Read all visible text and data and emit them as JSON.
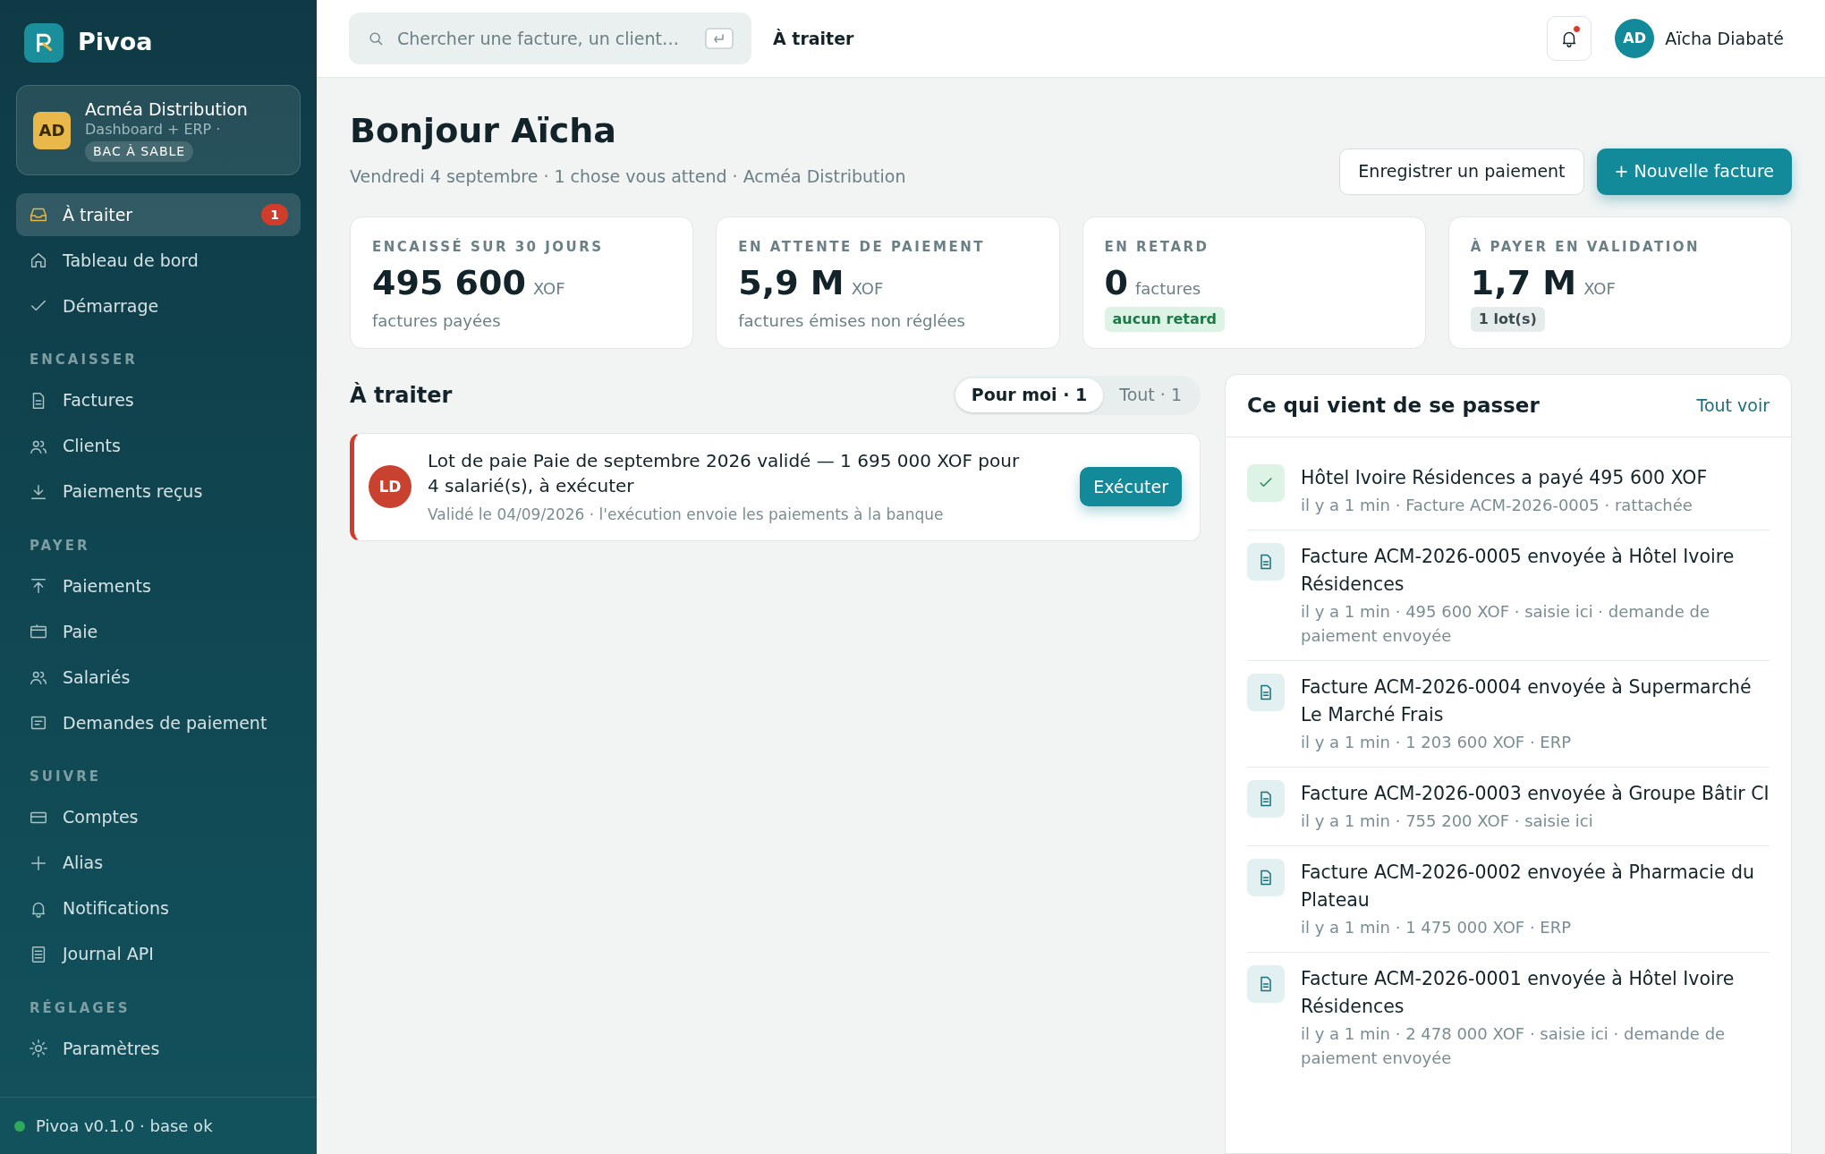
{
  "sidebar": {
    "brand": "Pivoa",
    "org": {
      "initials": "AD",
      "name": "Acméa Distribution",
      "subtitle": "Dashboard + ERP ·",
      "tag": "BAC À SABLE"
    },
    "groups": [
      {
        "items": [
          {
            "label": "À traiter",
            "selected": true,
            "badge": "1"
          },
          {
            "label": "Tableau de bord",
            "selected": false
          },
          {
            "label": "Démarrage",
            "selected": false
          }
        ]
      },
      {
        "heading": "ENCAISSER",
        "items": [
          {
            "label": "Factures",
            "selected": false
          },
          {
            "label": "Clients",
            "selected": false
          },
          {
            "label": "Paiements reçus",
            "selected": false
          }
        ]
      },
      {
        "heading": "PAYER",
        "items": [
          {
            "label": "Paiements",
            "selected": false
          },
          {
            "label": "Paie",
            "selected": false
          },
          {
            "label": "Salariés",
            "selected": false
          },
          {
            "label": "Demandes de paiement",
            "selected": false
          }
        ]
      },
      {
        "heading": "SUIVRE",
        "items": [
          {
            "label": "Comptes",
            "selected": false
          },
          {
            "label": "Alias",
            "selected": false
          },
          {
            "label": "Notifications",
            "selected": false
          },
          {
            "label": "Journal API",
            "selected": false
          }
        ]
      },
      {
        "heading": "RÉGLAGES",
        "items": [
          {
            "label": "Paramètres",
            "selected": false
          }
        ]
      }
    ],
    "footer": {
      "text": "Pivoa v0.1.0 · base ok",
      "status_ok": true
    }
  },
  "topbar": {
    "search": {
      "placeholder": "Chercher une facture, un client…"
    },
    "page_title": "À traiter",
    "notifications": {
      "unread": true
    },
    "user": {
      "initials": "AD",
      "name": "Aïcha Diabaté"
    }
  },
  "header": {
    "title": "Bonjour Aïcha",
    "subtitle": "Vendredi 4 septembre · 1 chose vous attend · Acméa Distribution",
    "buttons": [
      {
        "label": "Enregistrer un paiement",
        "kind": "secondary"
      },
      {
        "label": "+ Nouvelle facture",
        "kind": "primary"
      }
    ]
  },
  "kpis": [
    {
      "label": "ENCAISSÉ SUR 30 JOURS",
      "value": "495 600",
      "unit": "XOF",
      "note": "factures payées",
      "kind": "text"
    },
    {
      "label": "EN ATTENTE DE PAIEMENT",
      "value": "5,9 M",
      "unit": "XOF",
      "note": "factures émises non réglées",
      "kind": "text"
    },
    {
      "label": "EN RETARD",
      "value": "0",
      "unit": "factures",
      "note": "aucun retard",
      "kind": "success"
    },
    {
      "label": "À PAYER EN VALIDATION",
      "value": "1,7 M",
      "unit": "XOF",
      "note": "1 lot(s)",
      "kind": "neutral"
    }
  ],
  "tasks": {
    "title": "À traiter",
    "filters": [
      {
        "label": "Pour moi · 1",
        "selected": true
      },
      {
        "label": "Tout · 1",
        "selected": false
      }
    ],
    "items": [
      {
        "initials": "LD",
        "title": "Lot de paie Paie de septembre 2026 validé — 1 695 000 XOF pour 4 salarié(s), à exécuter",
        "meta": "Validé le 04/09/2026 · l'exécution envoie les paiements à la banque",
        "action": "Exécuter"
      }
    ]
  },
  "activity": {
    "title": "Ce qui vient de se passer",
    "link": "Tout voir",
    "items": [
      {
        "kind": "payment",
        "title": "Hôtel Ivoire Résidences a payé 495 600 XOF",
        "meta": "il y a 1 min · Facture ACM-2026-0005 · rattachée"
      },
      {
        "kind": "invoice",
        "title": "Facture ACM-2026-0005 envoyée à Hôtel Ivoire Résidences",
        "meta": "il y a 1 min · 495 600 XOF · saisie ici · demande de paiement envoyée"
      },
      {
        "kind": "invoice",
        "title": "Facture ACM-2026-0004 envoyée à Supermarché Le Marché Frais",
        "meta": "il y a 1 min · 1 203 600 XOF · ERP"
      },
      {
        "kind": "invoice",
        "title": "Facture ACM-2026-0003 envoyée à Groupe Bâtir CI",
        "meta": "il y a 1 min · 755 200 XOF · saisie ici"
      },
      {
        "kind": "invoice",
        "title": "Facture ACM-2026-0002 envoyée à Pharmacie du Plateau",
        "meta": "il y a 1 min · 1 475 000 XOF · ERP"
      },
      {
        "kind": "invoice",
        "title": "Facture ACM-2026-0001 envoyée à Hôtel Ivoire Résidences",
        "meta": "il y a 1 min · 2 478 000 XOF · saisie ici · demande de paiement envoyée"
      }
    ]
  }
}
